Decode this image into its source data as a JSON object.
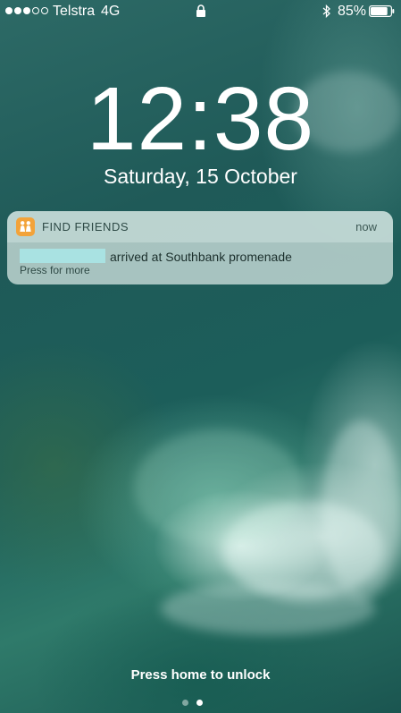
{
  "status_bar": {
    "signal_bars_filled": 3,
    "signal_bars_total": 5,
    "carrier": "Telstra",
    "network": "4G",
    "battery_percent": "85%",
    "battery_level": 0.85,
    "icons": [
      "lock-icon",
      "bluetooth-icon",
      "battery-icon"
    ]
  },
  "lock_screen": {
    "time": "12:38",
    "date": "Saturday, 15 October",
    "unlock_hint": "Press home to unlock",
    "pages_total": 2,
    "active_page": 2
  },
  "notification": {
    "app_icon": "find-friends-icon",
    "app_icon_color": "#f2a33a",
    "app_name": "FIND FRIENDS",
    "time": "now",
    "message": "arrived at Southbank promenade",
    "subtitle": "Press for more"
  }
}
